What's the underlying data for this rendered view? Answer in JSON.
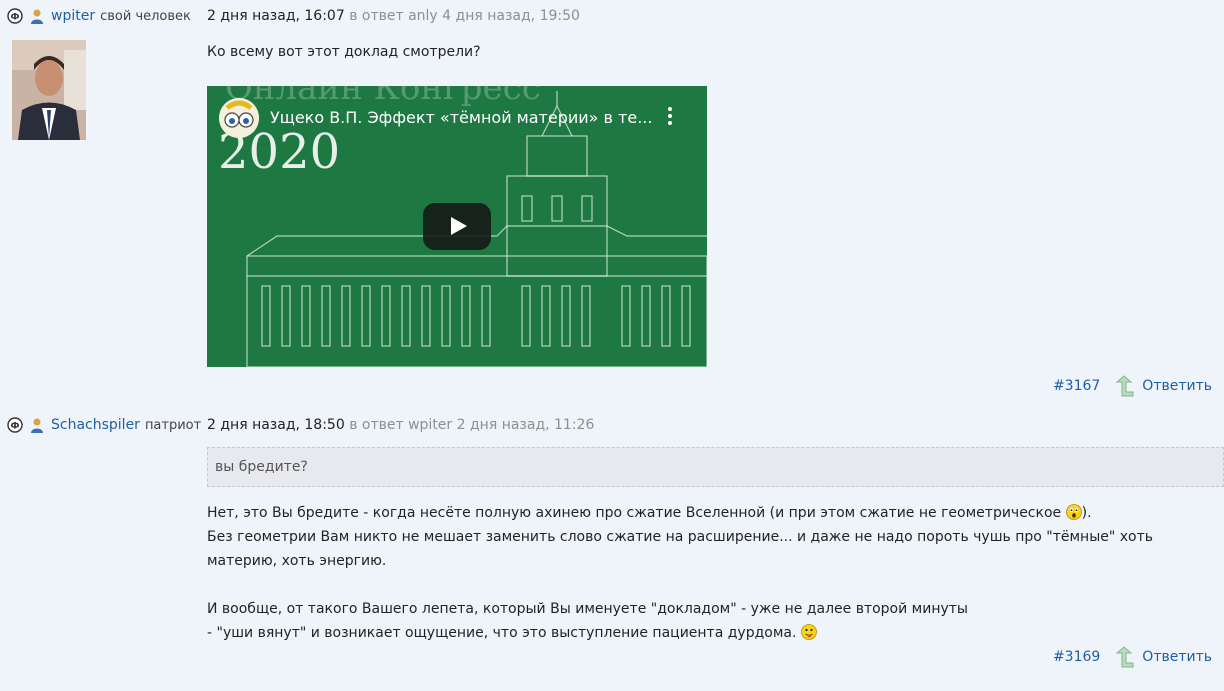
{
  "posts": [
    {
      "author": "wpiter",
      "status": "свой человек",
      "time": "2 дня назад, 16:07",
      "reply_to": "в ответ anly 4 дня назад, 19:50",
      "text": "Ко всему вот этот доклад смотрели?",
      "video": {
        "background_title": "Онлайн Конгресс",
        "year": "2020",
        "title": "Ущеко В.П. Эффект «тёмной материи» в те...",
        "kebab": "⋮"
      },
      "number": "#3167",
      "reply_label": "Ответить"
    },
    {
      "author": "Schachspiler",
      "status": "патриот",
      "time": "2 дня назад, 18:50",
      "reply_to": "в ответ wpiter 2 дня назад, 11:26",
      "quote": "вы бредите?",
      "line1": "Нет, это Вы бредите - когда несёте полную ахинею про сжатие Вселенной (и при этом сжатие не геометрическое",
      "line1_end": ").",
      "line2": "Без геометрии Вам никто не мешает заменить слово сжатие на расширение... и даже не надо пороть чушь про \"тёмные\" хоть материю, хоть энергию.",
      "line3": "И вообще, от такого Вашего лепета, который Вы именуете \"докладом\" - уже не далее второй минуты",
      "line4": "- \"уши вянут\" и возникает ощущение, что это выступление пациента дурдома.",
      "number": "#3169",
      "reply_label": "Ответить"
    }
  ],
  "colors": {
    "page_bg": "#eff3fa",
    "link": "#1f5fa6",
    "video_bg": "#1e7842",
    "reply_arrow": "#8fc49a"
  }
}
